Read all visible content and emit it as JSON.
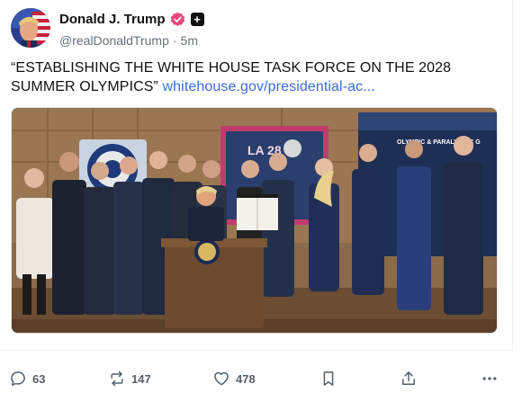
{
  "author": {
    "display_name": "Donald J. Trump",
    "handle": "@realDonaldTrump",
    "separator": "·",
    "time_ago": "5m",
    "verified_color": "#e8467c"
  },
  "post": {
    "text": "“ESTABLISHING THE WHITE HOUSE TASK FORCE ON THE 2028 SUMMER OLYMPICS”",
    "link_text": "whitehouse.gov/presidential-ac...",
    "link_color": "#3c6bd8"
  },
  "media": {
    "backdrop_text": "OLYMPIC & PARALYMPIC G",
    "screen_text": "LA 28"
  },
  "actions": {
    "reply_count": "63",
    "repost_count": "147",
    "like_count": "478"
  },
  "icons": {
    "reply": "comment-bubble-icon",
    "repost": "repost-arrows-icon",
    "like": "heart-icon",
    "bookmark": "bookmark-icon",
    "share": "share-upload-icon",
    "more": "more-dots-icon"
  }
}
